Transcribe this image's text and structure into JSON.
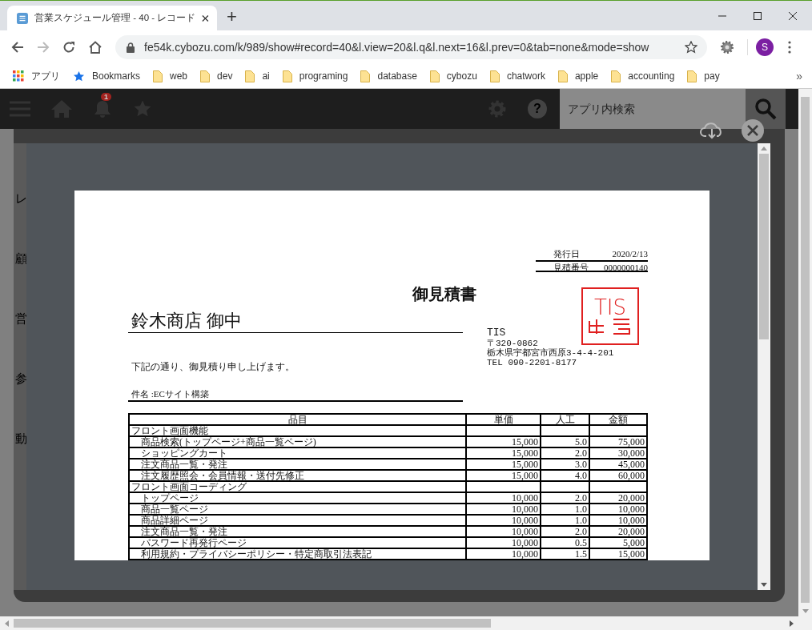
{
  "browser": {
    "tab_title": "営業スケジュール管理 - 40 - レコード",
    "new_tab": "+",
    "url": "fe54k.cybozu.com/k/989/show#record=40&l.view=20&l.q&l.next=16&l.prev=0&tab=none&mode=show",
    "profile": "S",
    "bookmarks": [
      {
        "kind": "apps",
        "label": "アプリ"
      },
      {
        "kind": "star",
        "label": "Bookmarks"
      },
      {
        "kind": "folder",
        "label": "web"
      },
      {
        "kind": "folder",
        "label": "dev"
      },
      {
        "kind": "folder",
        "label": "ai"
      },
      {
        "kind": "folder",
        "label": "programing"
      },
      {
        "kind": "folder",
        "label": "database"
      },
      {
        "kind": "folder",
        "label": "cybozu"
      },
      {
        "kind": "folder",
        "label": "chatwork"
      },
      {
        "kind": "folder",
        "label": "apple"
      },
      {
        "kind": "folder",
        "label": "accounting"
      },
      {
        "kind": "folder",
        "label": "pay"
      }
    ],
    "more": "»"
  },
  "app_header": {
    "notification_count": "1",
    "help": "?",
    "search": {
      "placeholder": "アプリ内検索"
    }
  },
  "background_labels": [
    "レ",
    "顧",
    "営",
    "参",
    "動"
  ],
  "document": {
    "meta": [
      {
        "label": "発行日",
        "value": "2020/2/13"
      },
      {
        "label": "見積番号",
        "value": "0000000140"
      }
    ],
    "title": "御見積書",
    "recipient": "鈴木商店 御中",
    "stamp": "TIS",
    "company": [
      "TIS",
      "〒320-0862",
      "栃木県宇都宮市西原3-4-4-201",
      "TEL 090-2201-8177"
    ],
    "greeting": "下記の通り、御見積り申し上げます。",
    "subject": "件名 :ECサイト構築",
    "table": {
      "columns": [
        "品目",
        "単価",
        "人工",
        "金額"
      ],
      "rows": [
        {
          "kind": "section",
          "item": "フロント画面機能",
          "unit_price": "",
          "effort": "",
          "amount": ""
        },
        {
          "kind": "item",
          "item": "商品検索(トップページ+商品一覧ページ)",
          "unit_price": "15,000",
          "effort": "5.0",
          "amount": "75,000"
        },
        {
          "kind": "item",
          "item": "ショッピングカート",
          "unit_price": "15,000",
          "effort": "2.0",
          "amount": "30,000"
        },
        {
          "kind": "item",
          "item": "注文商品一覧・発注",
          "unit_price": "15,000",
          "effort": "3.0",
          "amount": "45,000"
        },
        {
          "kind": "item",
          "item": "注文履歴照会・会員情報・送付先修正",
          "unit_price": "15,000",
          "effort": "4.0",
          "amount": "60,000"
        },
        {
          "kind": "section",
          "item": "フロント画面コーディング",
          "unit_price": "",
          "effort": "",
          "amount": ""
        },
        {
          "kind": "item",
          "item": "トップページ",
          "unit_price": "10,000",
          "effort": "2.0",
          "amount": "20,000"
        },
        {
          "kind": "item",
          "item": "商品一覧ページ",
          "unit_price": "10,000",
          "effort": "1.0",
          "amount": "10,000"
        },
        {
          "kind": "item",
          "item": "商品詳細ページ",
          "unit_price": "10,000",
          "effort": "1.0",
          "amount": "10,000"
        },
        {
          "kind": "item",
          "item": "注文商品一覧・発注",
          "unit_price": "10,000",
          "effort": "2.0",
          "amount": "20,000"
        },
        {
          "kind": "item",
          "item": "パスワード再発行ページ",
          "unit_price": "10,000",
          "effort": "0.5",
          "amount": "5,000"
        },
        {
          "kind": "item",
          "item": "利用規約・プライバシーポリシー・特定商取引法表記",
          "unit_price": "10,000",
          "effort": "1.5",
          "amount": "15,000"
        }
      ]
    }
  }
}
